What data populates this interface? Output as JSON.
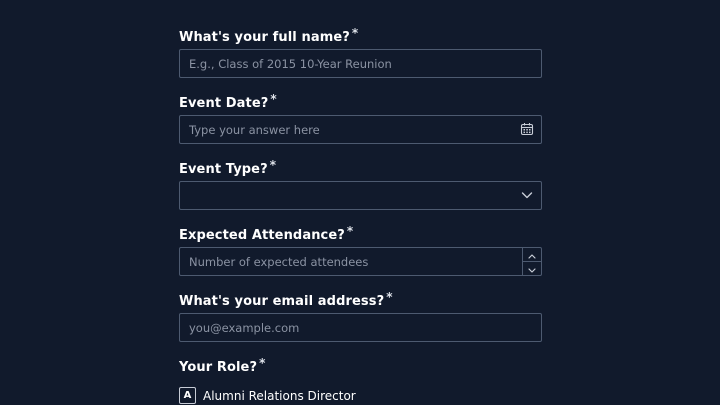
{
  "form": {
    "name": {
      "label": "What's your full name?",
      "required_mark": "*",
      "placeholder": "E.g., Class of 2015 10-Year Reunion",
      "value": ""
    },
    "event_date": {
      "label": "Event Date?",
      "required_mark": "*",
      "placeholder": "Type your answer here",
      "value": "",
      "icon": "calendar-icon"
    },
    "event_type": {
      "label": "Event Type?",
      "required_mark": "*",
      "selected": "",
      "icon": "chevron-down-icon"
    },
    "attendance": {
      "label": "Expected Attendance?",
      "required_mark": "*",
      "placeholder": "Number of expected attendees",
      "value": ""
    },
    "email": {
      "label": "What's your email address?",
      "required_mark": "*",
      "placeholder": "you@example.com",
      "value": ""
    },
    "role": {
      "label": "Your Role?",
      "required_mark": "*",
      "choices": [
        {
          "key": "A",
          "label": "Alumni Relations Director"
        }
      ]
    }
  },
  "colors": {
    "background": "#111a2c",
    "border": "#4d5a70",
    "text": "#ffffff",
    "placeholder": "#8b93a3"
  }
}
